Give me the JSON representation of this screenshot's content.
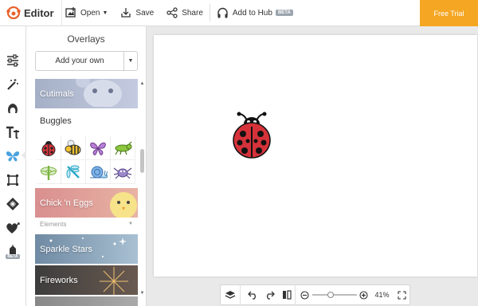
{
  "app": {
    "title": "Editor"
  },
  "toolbar": {
    "open_label": "Open",
    "save_label": "Save",
    "share_label": "Share",
    "hub_label": "Add to Hub",
    "hub_badge": "BETA",
    "trial_label": "Free Trial"
  },
  "sidebar": {
    "beta_badge": "BETA",
    "tools": [
      "basic-edits-icon",
      "effects-icon",
      "touch-up-icon",
      "text-icon",
      "overlays-icon",
      "frames-icon",
      "textures-icon",
      "favorites-icon",
      "seasonal-icon"
    ]
  },
  "panel": {
    "title": "Overlays",
    "add_own_label": "Add your own",
    "categories": {
      "cutimals": "Cutimals",
      "buggles": "Buggles",
      "chick_eggs": "Chick 'n Eggs",
      "section_elements": "Elements",
      "sparkle_stars": "Sparkle Stars",
      "fireworks": "Fireworks"
    },
    "buggles_items": [
      "ladybug",
      "bee",
      "butterfly",
      "grasshopper",
      "dragonfly-green",
      "dragonfly-blue",
      "snail",
      "spider"
    ]
  },
  "bottom": {
    "zoom_value": "41%",
    "zoom_level": 0.41
  },
  "colors": {
    "accent": "#f5a623",
    "brand": "#e8612c",
    "overlay_icon": "#4aa3df",
    "workspace": "#e9e9e9"
  }
}
